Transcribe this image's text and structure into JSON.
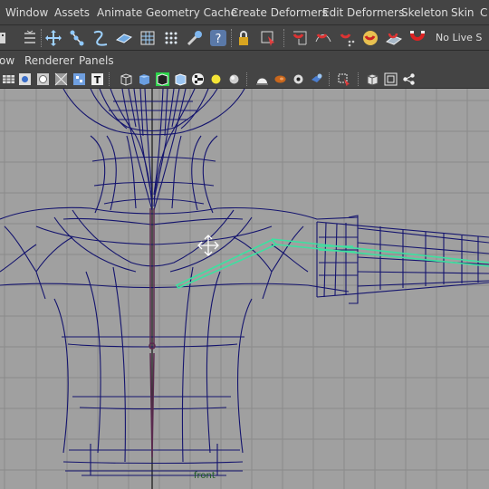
{
  "menubar": {
    "items": [
      "Window",
      "Assets",
      "Animate",
      "Geometry Cache",
      "Create Deformers",
      "Edit Deformers",
      "Skeleton",
      "Skin",
      "C"
    ]
  },
  "shelf": {
    "live_text": "No Live S",
    "icons": [
      "grid-menu-icon",
      "move-tool-icon",
      "joint-tool-icon",
      "ik-handle-icon",
      "curve-tool-icon",
      "lattice-icon",
      "cluster-icon",
      "sculpt-deformer-icon",
      "paint-weights-icon",
      "help-icon",
      "lock-icon",
      "select-object-icon",
      "snap-grid-icon",
      "snap-curve-icon",
      "snap-point-icon",
      "snap-view-icon",
      "make-live-icon",
      "magnet-icon"
    ]
  },
  "panel_menu": {
    "items": [
      "ow",
      "Renderer",
      "Panels"
    ]
  },
  "panel_toolbar": {
    "icons": [
      "camera-attributes-icon",
      "image-plane-icon",
      "bookmark-icon",
      "resolution-gate-icon",
      "grid-toggle-icon",
      "film-gate-icon",
      "text-overlay-icon",
      "wireframe-icon",
      "smooth-shade-icon",
      "wireframe-on-shaded-icon",
      "xray-icon",
      "textured-icon",
      "use-all-lights-icon",
      "shadows-icon",
      "ambient-occlusion-icon",
      "motion-blur-icon",
      "antialias-icon",
      "isolate-select-icon",
      "xray-joints-icon",
      "xray-active-icon",
      "share-icon"
    ]
  },
  "viewport": {
    "camera": "front",
    "background": "#a0a0a0",
    "grid_color": "#8a8a8a",
    "wireframe_color": "#14146e",
    "joint_color": "#3ce1a0"
  }
}
